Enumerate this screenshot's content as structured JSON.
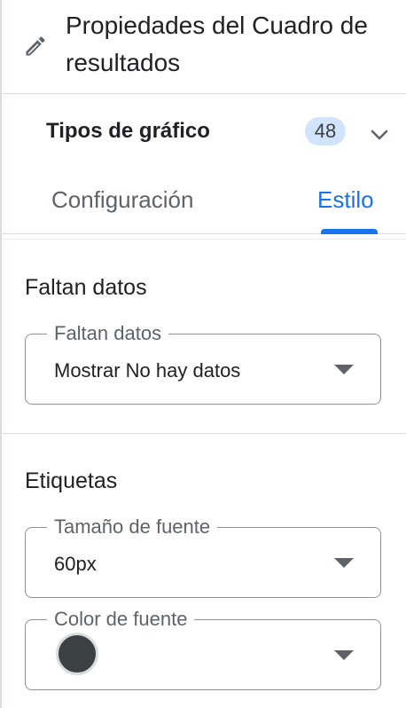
{
  "header": {
    "title": "Propiedades del Cuadro de resultados"
  },
  "chart_types": {
    "label": "Tipos de gráfico",
    "count": "48"
  },
  "tabs": [
    {
      "label": "Configuración",
      "active": false
    },
    {
      "label": "Estilo",
      "active": true
    }
  ],
  "missing_data": {
    "section_title": "Faltan datos",
    "field_label": "Faltan datos",
    "field_value": "Mostrar No hay datos"
  },
  "labels": {
    "section_title": "Etiquetas",
    "font_size_label": "Tamaño de fuente",
    "font_size_value": "60px",
    "font_color_label": "Color de fuente",
    "font_color_value": "#3c4043"
  },
  "colors": {
    "accent": "#1a73e8",
    "badge_bg": "#d2e3fc"
  }
}
